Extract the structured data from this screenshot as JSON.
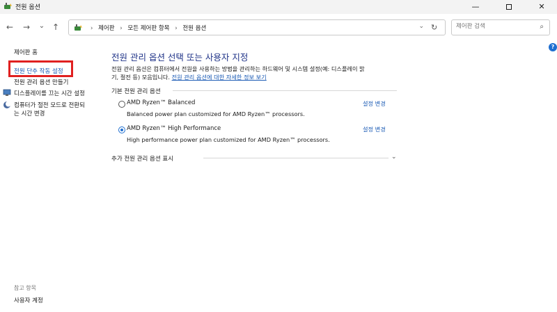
{
  "window": {
    "title": "전원 옵션",
    "minimize": "—",
    "close": "✕"
  },
  "nav": {
    "back": "←",
    "forward": "→",
    "recent": "⌄",
    "up": "↑"
  },
  "address": {
    "crumbs": [
      "제어판",
      "모든 제어판 항목",
      "전원 옵션"
    ],
    "separator": "›",
    "dropdown": "⌄",
    "refresh": "↻"
  },
  "search": {
    "placeholder": "제어판 검색",
    "icon": "⌕"
  },
  "help": {
    "label": "?"
  },
  "sidebar": {
    "home": "제어판 홈",
    "items": [
      {
        "label": "전원 단추 작동 설정"
      },
      {
        "label": "전원 관리 옵션 만들기"
      },
      {
        "label": "디스플레이를 끄는 시간 설정"
      },
      {
        "label_line1": "컴퓨터가 절전 모드로 전환되",
        "label_line2": "는 시간 변경"
      }
    ],
    "see_also": "참고 항목",
    "user_accounts": "사용자 계정"
  },
  "main": {
    "title": "전원 관리 옵션 선택 또는 사용자 지정",
    "desc_line1": "전원 관리 옵션은 컴퓨터에서 전원을 사용하는 방법을 관리하는 하드웨어 및 시스템 설정(예: 디스플레이 밝",
    "desc_line2": "기, 절전 등) 모음입니다. ",
    "desc_link": "전원 관리 옵션에 대한 자세한 정보 보기",
    "section_label": "기본 전원 관리 옵션",
    "plans": [
      {
        "name": "AMD Ryzen™ Balanced",
        "desc": "Balanced power plan customized for AMD Ryzen™ processors.",
        "change": "설정 변경",
        "selected": false
      },
      {
        "name": "AMD Ryzen™ High Performance",
        "desc": "High performance power plan customized for AMD Ryzen™ processors.",
        "change": "설정 변경",
        "selected": true
      }
    ],
    "more_label": "추가 전원 관리 옵션 표시",
    "more_icon": "⌄"
  },
  "colors": {
    "link": "#1a5ab4",
    "title": "#1e3287",
    "highlight": "#e02020",
    "accent": "#1f6fd0"
  }
}
